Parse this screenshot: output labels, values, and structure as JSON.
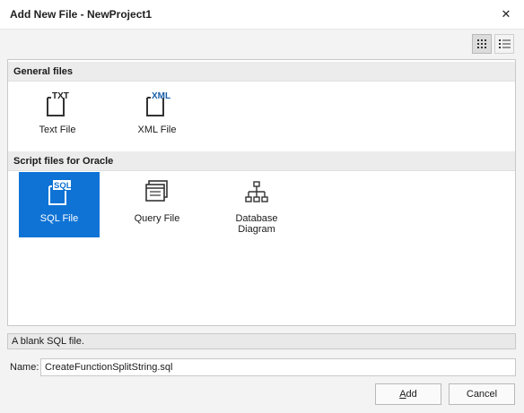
{
  "window": {
    "title": "Add New File - NewProject1",
    "close_glyph": "✕"
  },
  "toolbar": {
    "large_icons_view": "grid-icon",
    "list_view": "list-icon"
  },
  "groups": [
    {
      "label": "General files",
      "items": [
        {
          "label": "Text File",
          "icon": "txt-file-icon",
          "badge": "TXT"
        },
        {
          "label": "XML File",
          "icon": "xml-file-icon",
          "badge": "XML"
        }
      ]
    },
    {
      "label": "Script files for Oracle",
      "items": [
        {
          "label": "SQL File",
          "icon": "sql-file-icon",
          "badge": "SQL",
          "selected": true
        },
        {
          "label": "Query File",
          "icon": "query-file-icon"
        },
        {
          "label_line1": "Database",
          "label_line2": "Diagram",
          "icon": "database-diagram-icon"
        }
      ]
    }
  ],
  "description": "A blank SQL file.",
  "name_field": {
    "label": "Name:",
    "value": "CreateFunctionSplitString.sql"
  },
  "buttons": {
    "add_mnemonic": "A",
    "add_rest": "dd",
    "cancel": "Cancel"
  },
  "colors": {
    "selection": "#0f73d6",
    "xml_badge": "#1a5fa8"
  }
}
